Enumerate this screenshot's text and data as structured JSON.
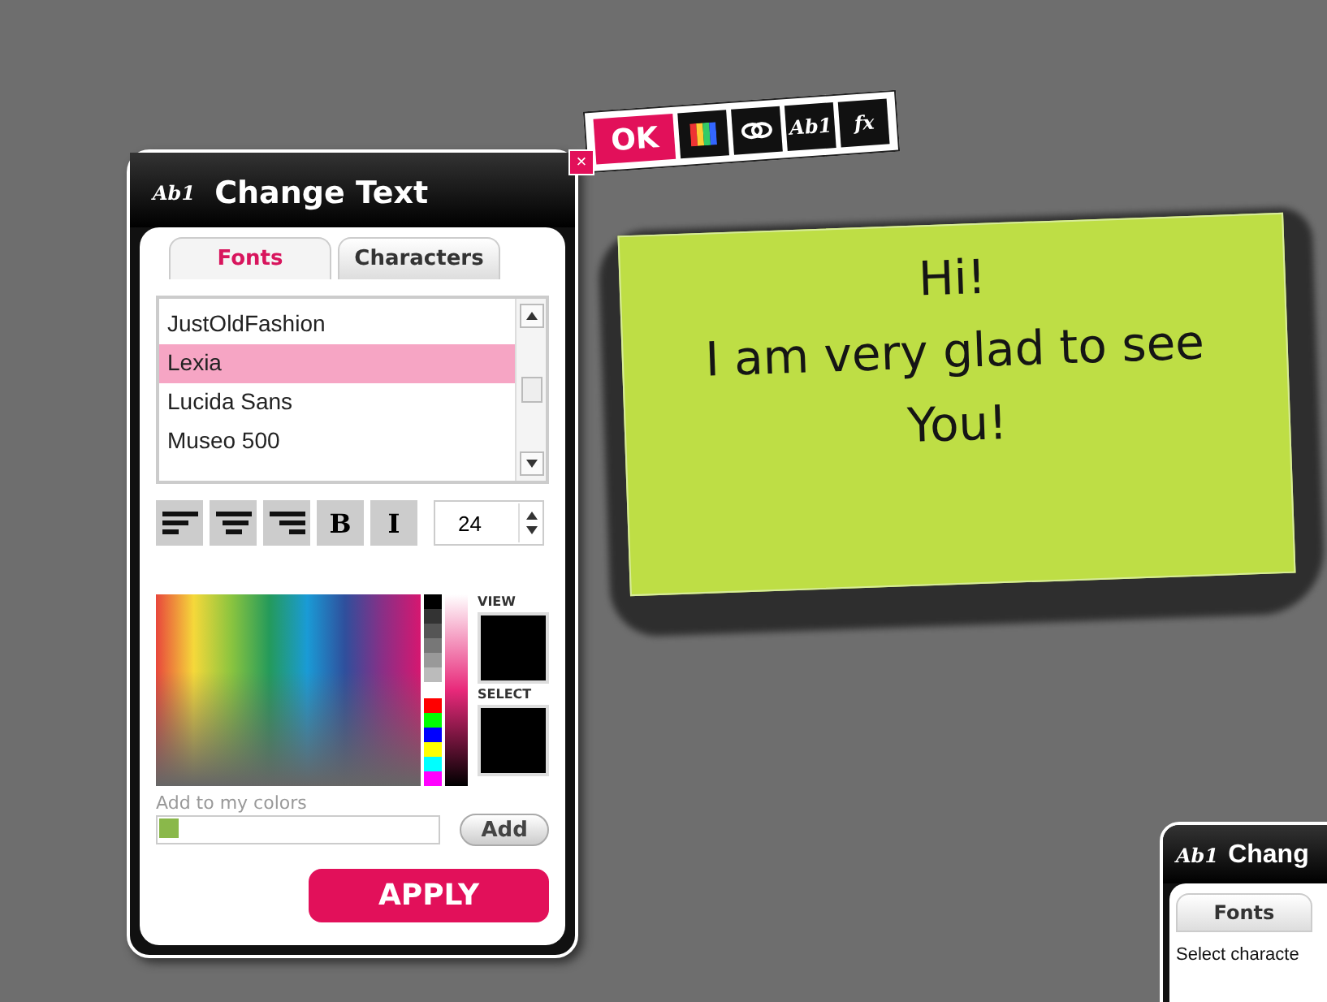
{
  "toolbar": {
    "items": [
      {
        "kind": "ok",
        "label": "OK"
      },
      {
        "kind": "palette"
      },
      {
        "kind": "link"
      },
      {
        "kind": "text",
        "label": "Ab1"
      },
      {
        "kind": "text",
        "label": "fx"
      }
    ]
  },
  "dialog": {
    "logo": "Ab1",
    "title": "Change Text",
    "close": "×",
    "tabs": [
      {
        "label": "Fonts",
        "selected": true
      },
      {
        "label": "Characters",
        "selected": false
      }
    ],
    "fonts": [
      {
        "label": "JustOldFashion",
        "selected": false
      },
      {
        "label": "Lexia",
        "selected": true
      },
      {
        "label": "Lucida Sans",
        "selected": false
      },
      {
        "label": "Museo 500",
        "selected": false
      }
    ],
    "format": [
      {
        "kind": "align-left"
      },
      {
        "kind": "align-center"
      },
      {
        "kind": "align-right"
      },
      {
        "kind": "text",
        "label": "B"
      },
      {
        "kind": "text",
        "label": "I"
      }
    ],
    "size": "24",
    "view_label": "VIEW",
    "select_label": "SELECT",
    "add_hint": "Add to my colors",
    "my_colors": [
      {
        "color": "#8ab84a"
      }
    ],
    "add_button": "Add",
    "apply_button": "APPLY"
  },
  "note": {
    "lines": [
      "Hi!",
      "I am very glad to see",
      "You!"
    ]
  },
  "second_dialog": {
    "logo": "Ab1",
    "title": "Chang",
    "tab": "Fonts",
    "text": "Select characte"
  }
}
